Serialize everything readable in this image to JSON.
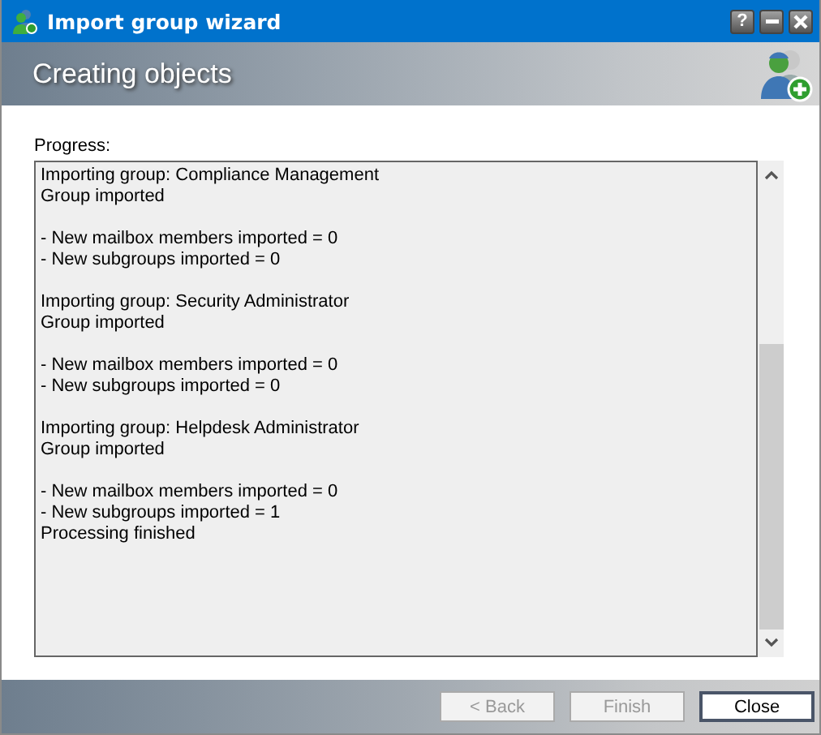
{
  "window": {
    "title": "Import group wizard",
    "controls": [
      {
        "kind": "help",
        "label": "?"
      },
      {
        "kind": "minimize"
      },
      {
        "kind": "close"
      }
    ]
  },
  "header": {
    "title": "Creating objects"
  },
  "progress": {
    "label": "Progress:",
    "blocks": [
      {
        "lines": [
          "Importing group: Compliance Management",
          "Group imported"
        ]
      },
      {
        "lines": [
          "- New mailbox members imported = 0",
          "- New subgroups imported = 0"
        ]
      },
      {
        "lines": [
          "Importing group: Security Administrator",
          "Group imported"
        ]
      },
      {
        "lines": [
          "- New mailbox members imported = 0",
          "- New subgroups imported = 0"
        ]
      },
      {
        "lines": [
          "Importing group: Helpdesk Administrator",
          "Group imported"
        ]
      },
      {
        "lines": [
          "- New mailbox members imported = 0",
          "- New subgroups imported = 1",
          "Processing finished"
        ]
      }
    ]
  },
  "buttons": [
    {
      "label": "< Back",
      "disabled": true,
      "default": false
    },
    {
      "label": "Finish",
      "disabled": true,
      "default": false
    },
    {
      "label": "Close",
      "disabled": false,
      "default": true
    }
  ]
}
